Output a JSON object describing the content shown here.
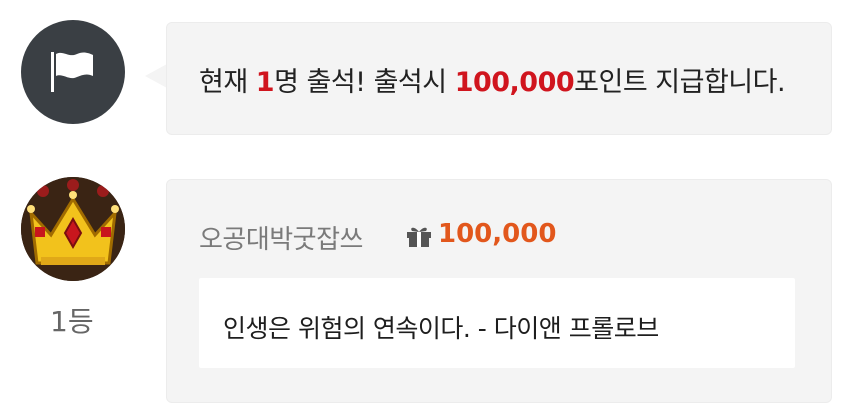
{
  "attendance_notice": {
    "prefix": "현재 ",
    "count": "1",
    "middle": "명 출석! 출석시 ",
    "points": "100,000",
    "suffix": "포인트 지급합니다.",
    "highlight_color": "#d0151e"
  },
  "entry": {
    "rank": "1등",
    "nickname": "오공대박굿잡쓰",
    "points": "100,000",
    "points_color": "#e2571c",
    "quote": "인생은 위험의 연속이다. - 다이앤 프롤로브"
  },
  "icons": {
    "notice_avatar": "flag-icon",
    "entry_avatar": "crown-icon",
    "points_icon": "gift-icon"
  }
}
